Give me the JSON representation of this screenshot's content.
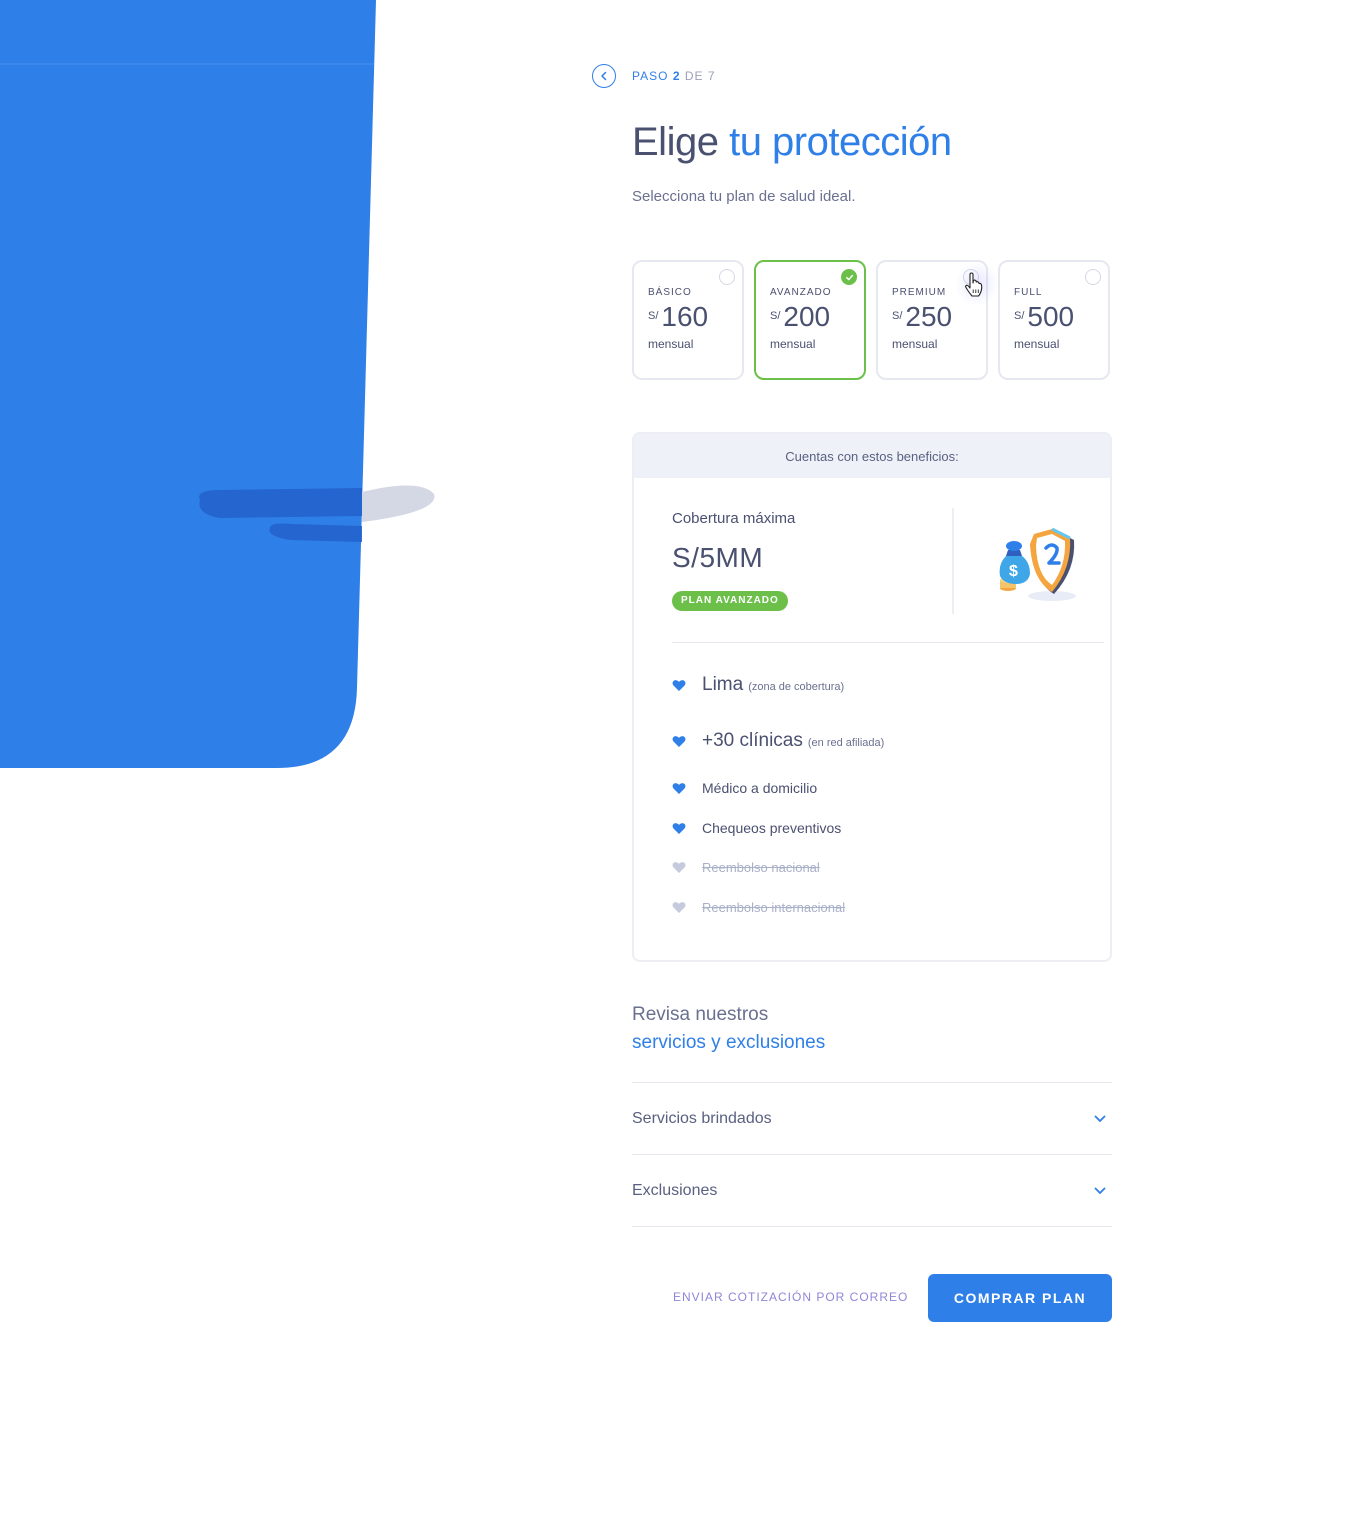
{
  "colors": {
    "accent": "#2f7fe9",
    "selected": "#6cc04a",
    "text": "#4a5070",
    "muted": "#aab0c8"
  },
  "step": {
    "prefix": "PASO",
    "current": "2",
    "of": "DE 7"
  },
  "title": {
    "plain": "Elige",
    "accent": "tu protección"
  },
  "subtitle": "Selecciona tu plan de salud ideal.",
  "plans": [
    {
      "name": "BÁSICO",
      "currency": "S/",
      "amount": "160",
      "period": "mensual",
      "selected": false
    },
    {
      "name": "AVANZADO",
      "currency": "S/",
      "amount": "200",
      "period": "mensual",
      "selected": true
    },
    {
      "name": "PREMIUM",
      "currency": "S/",
      "amount": "250",
      "period": "mensual",
      "selected": false
    },
    {
      "name": "FULL",
      "currency": "S/",
      "amount": "500",
      "period": "mensual",
      "selected": false
    }
  ],
  "benefits": {
    "header": "Cuentas con estos beneficios:",
    "coverage_label": "Cobertura máxima",
    "coverage_value": "S/5MM",
    "badge": "PLAN AVANZADO",
    "items": [
      {
        "text": "Lima",
        "note": "(zona de cobertura)",
        "included": true
      },
      {
        "text": "+30 clínicas",
        "note": "(en red afiliada)",
        "included": true
      },
      {
        "text": "Médico a domicilio",
        "included": true
      },
      {
        "text": "Chequeos preventivos",
        "included": true
      },
      {
        "text": "Reembolso nacional",
        "included": false
      },
      {
        "text": "Reembolso internacional",
        "included": false
      }
    ]
  },
  "review": {
    "line1": "Revisa nuestros",
    "line2": "servicios y exclusiones"
  },
  "accordion": [
    {
      "label": "Servicios brindados"
    },
    {
      "label": "Exclusiones"
    }
  ],
  "actions": {
    "email_link": "ENVIAR COTIZACIÓN POR CORREO",
    "buy_button": "COMPRAR PLAN"
  }
}
